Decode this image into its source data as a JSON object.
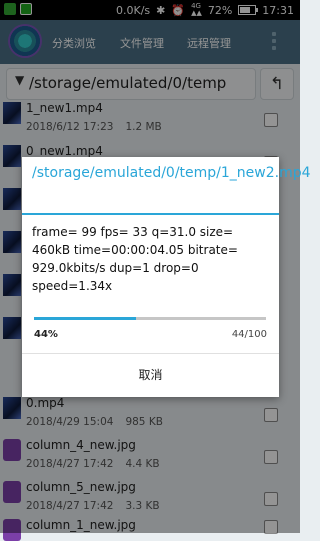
{
  "status_bar": {
    "net_speed": "0.0K/s",
    "battery": "72%",
    "battery_level": 0.72,
    "time": "17:31",
    "icons": [
      "notification-icon",
      "app-icon",
      "bluetooth-icon",
      "alarm-icon",
      "signal-4g-icon",
      "battery-icon"
    ]
  },
  "header": {
    "tabs": [
      {
        "label": "分类浏览"
      },
      {
        "label": "文件管理"
      },
      {
        "label": "远程管理"
      }
    ],
    "accent": "#4a6f86"
  },
  "path_bar": {
    "path": "/storage/emulated/0/temp",
    "up_icon": "up-arrow-icon"
  },
  "files": [
    {
      "name": "1_new1.mp4",
      "date": "2018/6/12 17:23",
      "size": "1.2 MB",
      "thumb": "video"
    },
    {
      "name": "0_new1.mp4",
      "date": "",
      "size": "",
      "thumb": "video"
    },
    {
      "name": "",
      "date": "",
      "size": "",
      "thumb": "video"
    },
    {
      "name": "",
      "date": "",
      "size": "",
      "thumb": "video"
    },
    {
      "name": "",
      "date": "",
      "size": "",
      "thumb": "video"
    },
    {
      "name": "",
      "date": "",
      "size": "",
      "thumb": "video"
    },
    {
      "name": "0.mp4",
      "date": "2018/4/29 15:04",
      "size": "985 KB",
      "thumb": "video"
    },
    {
      "name": "column_4_new.jpg",
      "date": "2018/4/27 17:42",
      "size": "4.4 KB",
      "thumb": "img"
    },
    {
      "name": "column_5_new.jpg",
      "date": "2018/4/27 17:42",
      "size": "3.3 KB",
      "thumb": "img"
    },
    {
      "name": "column_1_new.jpg",
      "date": "",
      "size": "",
      "thumb": "img"
    }
  ],
  "dialog": {
    "title": "/storage/emulated/0/temp/1_new2.mp4",
    "message": "frame=   99 fps= 33 q=31.0 size=   460kB time=00:00:04.05 bitrate= 929.0kbits/s dup=1 drop=0 speed=1.34x",
    "progress_fraction": 0.44,
    "percent_label": "44%",
    "count_label": "44/100",
    "cancel_label": "取消",
    "accent": "#2aa6d8"
  }
}
